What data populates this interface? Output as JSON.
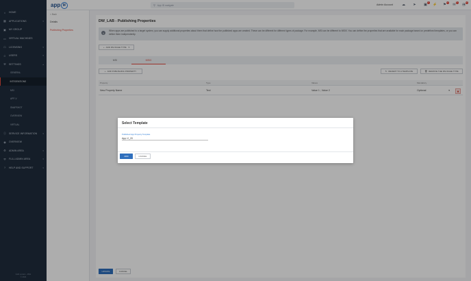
{
  "sidebar": {
    "items": [
      {
        "label": "HOME",
        "icon": "home-icon",
        "chev": false
      },
      {
        "label": "APPLICATIONS",
        "icon": "apps-icon",
        "chev": true
      },
      {
        "label": "MY GROUP",
        "icon": "group-icon",
        "chev": false
      },
      {
        "label": "VIRTUAL MACHINES",
        "icon": "monitor-icon",
        "chev": false
      },
      {
        "label": "LICENSING",
        "icon": "license-icon",
        "chev": true
      },
      {
        "label": "USERS",
        "icon": "users-icon",
        "chev": true
      },
      {
        "label": "SETTINGS",
        "icon": "wrench-icon",
        "chev": true
      }
    ],
    "subitems": [
      "GENERAL",
      "INTEGRATIONS",
      "MSI",
      "APP-V",
      "SNAPSHOT",
      "OVERVIEW",
      "VIRTUAL"
    ],
    "items_after": [
      {
        "label": "SERVICE INFORMATION",
        "icon": "info-icon",
        "chev": true
      },
      {
        "label": "OVERVIEW",
        "icon": "overview-icon",
        "chev": false
      },
      {
        "label": "ADMIN AREA",
        "icon": "gear-icon",
        "chev": true
      },
      {
        "label": "FULL ADMIN AREA",
        "icon": "shield-icon",
        "chev": true
      },
      {
        "label": "HELP AND SUPPORT",
        "icon": "help-icon",
        "chev": true
      }
    ],
    "footer_line1": "build version - 4811",
    "footer_line2": "© 2024"
  },
  "topbar": {
    "logo_text": "app",
    "logo_mark": "M",
    "search_placeholder": "App ID navigate",
    "admin_label": "Admin Account",
    "badges": {
      "notifications": "1",
      "bell": "14",
      "mail": "8",
      "messages": "12"
    }
  },
  "leftpanel": {
    "back": "< Back",
    "items": [
      "Details",
      "Publishing Properties"
    ]
  },
  "content": {
    "title": "DW_LAB - Publishing Properties",
    "info_text": "When apps are published to a target system, you can supply additional properties about them that define how the published apps are created. These can be different for different types of package. For example, MSI can be different to MSIX. You can define the properties that are available for each package based on predefined templates, or you can define them independently.",
    "add_package_type": "ADD PACKAGE TYPE",
    "tabs": [
      "MSI",
      "MSIX"
    ],
    "add_publishing_property": "ADD PUBLISHING PROPERTY",
    "revert_template": "REVERT TO A TEMPLATE",
    "remove_package_type": "REMOVE THE PACKAGE TYPE",
    "table": {
      "headers": [
        "Property",
        "Type",
        "Values",
        "Mandatory"
      ],
      "rows": [
        {
          "property": "New Property Name",
          "type": "Text",
          "values": "Value 1 ; Value 2",
          "mandatory": "Optional"
        }
      ]
    },
    "update_btn": "UPDATE",
    "cancel_btn": "CANCEL"
  },
  "modal": {
    "title": "Select Template",
    "field_label": "Published App Property Template",
    "field_value": "App-V_20",
    "add_btn": "ADD",
    "cancel_btn": "CANCEL"
  },
  "colors": {
    "accent": "#e04b3e",
    "primary": "#2f6fbd",
    "sidebar": "#1f2d3d"
  }
}
